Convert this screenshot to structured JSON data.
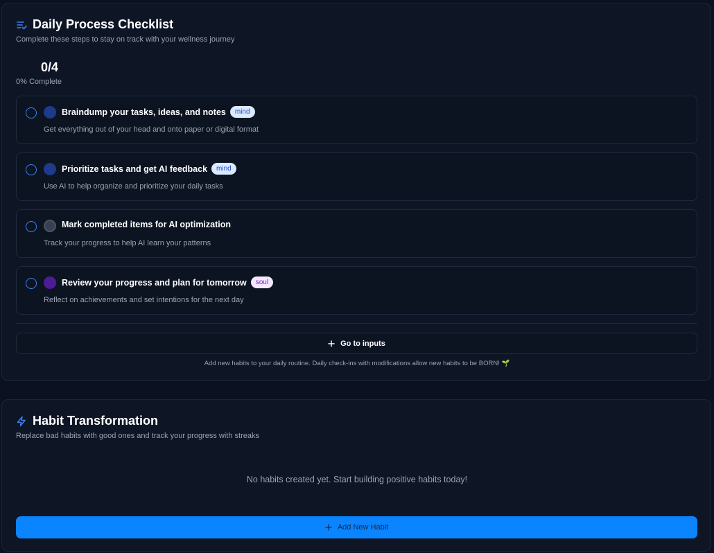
{
  "checklist": {
    "title": "Daily Process Checklist",
    "icon": "checklist-icon",
    "subtitle": "Complete these steps to stay on track with your wellness journey",
    "progress_count": "0/4",
    "progress_label": "0% Complete",
    "items": [
      {
        "title": "Braindump your tasks, ideas, and notes",
        "badge": "mind",
        "description": "Get everything out of your head and onto paper or digital format",
        "icon_color": "#1e3a8a"
      },
      {
        "title": "Prioritize tasks and get AI feedback",
        "badge": "mind",
        "description": "Use AI to help organize and prioritize your daily tasks",
        "icon_color": "#1e3a8a"
      },
      {
        "title": "Mark completed items for AI optimization",
        "badge": "",
        "description": "Track your progress to help AI learn your patterns",
        "icon_color": "#374151"
      },
      {
        "title": "Review your progress and plan for tomorrow",
        "badge": "soul",
        "description": "Reflect on achievements and set intentions for the next day",
        "icon_color": "#4c1d95"
      }
    ],
    "goto_label": "Go to inputs",
    "footnote": "Add new habits to your daily routine. Daily check-ins with modifications allow new habits to be BORN! 🌱"
  },
  "habits": {
    "title": "Habit Transformation",
    "icon": "lightning-icon",
    "subtitle": "Replace bad habits with good ones and track your progress with streaks",
    "empty_message": "No habits created yet. Start building positive habits today!",
    "add_label": "Add New Habit"
  },
  "colors": {
    "background": "#0b1120",
    "card": "#0e1626",
    "accent": "#0a84ff",
    "check_border": "#3b82f6"
  }
}
